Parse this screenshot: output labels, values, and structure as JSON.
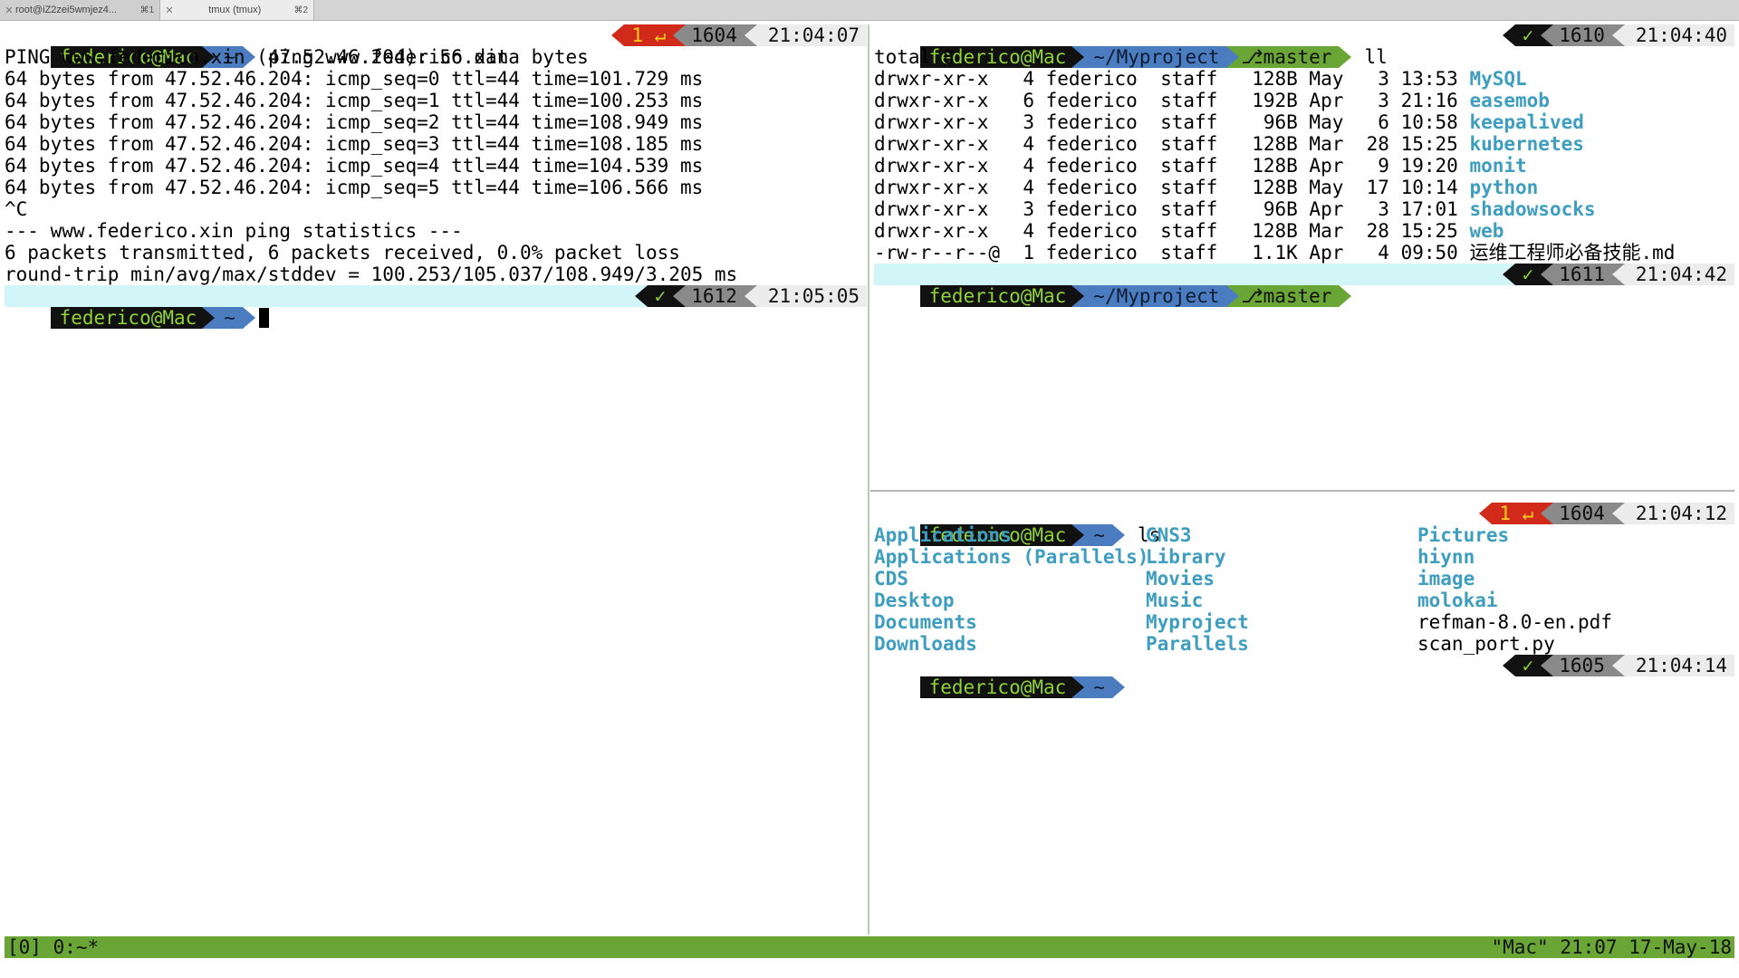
{
  "tabs": [
    {
      "title": "root@iZ2zei5wmjez4...",
      "shortcut": "⌘1"
    },
    {
      "title": "tmux (tmux)",
      "shortcut": "⌘2"
    }
  ],
  "left_pane": {
    "prompt1": {
      "user": "federico@Mac",
      "dir": "~",
      "command": "ping www.federico.xin",
      "status": "1 ↵",
      "hist": "1604",
      "time": "21:04:07"
    },
    "output": [
      "PING www.federico.xin (47.52.46.204): 56 data bytes",
      "64 bytes from 47.52.46.204: icmp_seq=0 ttl=44 time=101.729 ms",
      "64 bytes from 47.52.46.204: icmp_seq=1 ttl=44 time=100.253 ms",
      "64 bytes from 47.52.46.204: icmp_seq=2 ttl=44 time=108.949 ms",
      "64 bytes from 47.52.46.204: icmp_seq=3 ttl=44 time=108.185 ms",
      "64 bytes from 47.52.46.204: icmp_seq=4 ttl=44 time=104.539 ms",
      "64 bytes from 47.52.46.204: icmp_seq=5 ttl=44 time=106.566 ms",
      "^C",
      "--- www.federico.xin ping statistics ---",
      "6 packets transmitted, 6 packets received, 0.0% packet loss",
      "round-trip min/avg/max/stddev = 100.253/105.037/108.949/3.205 ms"
    ],
    "prompt2": {
      "user": "federico@Mac",
      "dir": "~",
      "status": "✓",
      "hist": "1612",
      "time": "21:05:05"
    }
  },
  "top_right_pane": {
    "prompt1": {
      "user": "federico@Mac",
      "dir": "~/Myproject",
      "branch": "master",
      "command": "ll",
      "status": "✓",
      "hist": "1610",
      "time": "21:04:40"
    },
    "total": "total 8",
    "rows": [
      {
        "meta": "drwxr-xr-x   4 federico  staff   128B May   3 13:53 ",
        "name": "MySQL",
        "dir": true
      },
      {
        "meta": "drwxr-xr-x   6 federico  staff   192B Apr   3 21:16 ",
        "name": "easemob",
        "dir": true
      },
      {
        "meta": "drwxr-xr-x   3 federico  staff    96B May   6 10:58 ",
        "name": "keepalived",
        "dir": true
      },
      {
        "meta": "drwxr-xr-x   4 federico  staff   128B Mar  28 15:25 ",
        "name": "kubernetes",
        "dir": true
      },
      {
        "meta": "drwxr-xr-x   4 federico  staff   128B Apr   9 19:20 ",
        "name": "monit",
        "dir": true
      },
      {
        "meta": "drwxr-xr-x   4 federico  staff   128B May  17 10:14 ",
        "name": "python",
        "dir": true
      },
      {
        "meta": "drwxr-xr-x   3 federico  staff    96B Apr   3 17:01 ",
        "name": "shadowsocks",
        "dir": true
      },
      {
        "meta": "drwxr-xr-x   4 federico  staff   128B Mar  28 15:25 ",
        "name": "web",
        "dir": true
      },
      {
        "meta": "-rw-r--r--@  1 federico  staff   1.1K Apr   4 09:50 ",
        "name": "运维工程师必备技能.md",
        "dir": false
      }
    ],
    "prompt2": {
      "user": "federico@Mac",
      "dir": "~/Myproject",
      "branch": "master",
      "status": "✓",
      "hist": "1611",
      "time": "21:04:42"
    }
  },
  "bottom_right_pane": {
    "prompt1": {
      "user": "federico@Mac",
      "dir": "~",
      "command": "ls",
      "status": "1 ↵",
      "hist": "1604",
      "time": "21:04:12"
    },
    "col1": [
      {
        "name": "Applications",
        "dir": true
      },
      {
        "name": "Applications (Parallels)",
        "dir": true
      },
      {
        "name": "CDS",
        "dir": true
      },
      {
        "name": "Desktop",
        "dir": true
      },
      {
        "name": "Documents",
        "dir": true
      },
      {
        "name": "Downloads",
        "dir": true
      }
    ],
    "col2": [
      {
        "name": "GNS3",
        "dir": true
      },
      {
        "name": "Library",
        "dir": true
      },
      {
        "name": "Movies",
        "dir": true
      },
      {
        "name": "Music",
        "dir": true
      },
      {
        "name": "Myproject",
        "dir": true
      },
      {
        "name": "Parallels",
        "dir": true
      }
    ],
    "col3": [
      {
        "name": "Pictures",
        "dir": true
      },
      {
        "name": "hiynn",
        "dir": true
      },
      {
        "name": "image",
        "dir": true
      },
      {
        "name": "molokai",
        "dir": true
      },
      {
        "name": "refman-8.0-en.pdf",
        "dir": false
      },
      {
        "name": "scan_port.py",
        "dir": false
      }
    ],
    "prompt2": {
      "user": "federico@Mac",
      "dir": "~",
      "status": "✓",
      "hist": "1605",
      "time": "21:04:14"
    }
  },
  "tmux": {
    "left": "[0] 0:~*",
    "right": "\"Mac\" 21:07 17-May-18"
  },
  "colors": {
    "prompt_user_bg": "#111111",
    "prompt_user_fg": "#8fd23a",
    "prompt_dir_bg": "#4b7cc0",
    "git_bg": "#6aa636",
    "error_bg": "#d12a1a",
    "dir_listing": "#3e9ec0",
    "tmux_bar": "#6aa636",
    "current_line": "#d2f5f7"
  }
}
